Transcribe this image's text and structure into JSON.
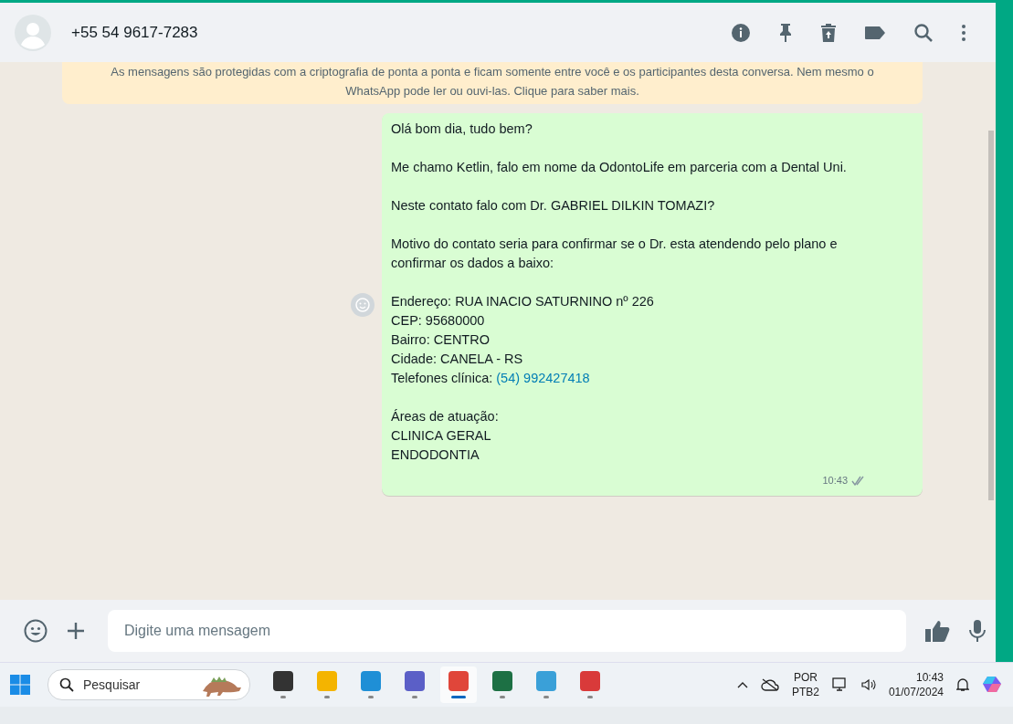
{
  "header": {
    "contact": "+55 54 9617-7283"
  },
  "notice": {
    "text": "As mensagens são protegidas com a criptografia de ponta a ponta e ficam somente entre você e os participantes desta conversa. Nem mesmo o WhatsApp pode ler ou ouvi-las. Clique para saber mais."
  },
  "message": {
    "paragraphs": [
      [
        {
          "text": "Olá bom dia, tudo bem?"
        }
      ],
      [
        {
          "text": "Me chamo Ketlin, falo em nome da OdontoLife em parceria com a Dental Uni."
        }
      ],
      [
        {
          "text": "Neste contato falo com Dr. GABRIEL DILKIN TOMAZI?"
        }
      ],
      [
        {
          "text": "Motivo do contato seria para confirmar se o Dr. esta atendendo pelo plano e confirmar os dados a baixo:"
        }
      ],
      [
        {
          "text": "Endereço: RUA INACIO SATURNINO nº 226"
        },
        {
          "text": "CEP: 95680000"
        },
        {
          "text": "Bairro: CENTRO"
        },
        {
          "text": "Cidade: CANELA - RS"
        },
        {
          "text": "Telefones clínica: ",
          "link": "(54) 992427418"
        }
      ],
      [
        {
          "text": "Áreas de atuação:"
        },
        {
          "text": "CLINICA GERAL"
        },
        {
          "text": "ENDODONTIA"
        }
      ]
    ],
    "time": "10:43"
  },
  "composer": {
    "placeholder": "Digite uma mensagem"
  },
  "taskbar": {
    "search_placeholder": "Pesquisar",
    "apps": [
      {
        "kind": "taskview",
        "selected": false
      },
      {
        "kind": "files",
        "selected": false
      },
      {
        "kind": "edge",
        "selected": false
      },
      {
        "kind": "teams",
        "selected": false
      },
      {
        "kind": "chrome",
        "selected": true
      },
      {
        "kind": "excel",
        "selected": false
      },
      {
        "kind": "notepad",
        "selected": false
      },
      {
        "kind": "snip",
        "selected": false
      }
    ],
    "language": "POR",
    "layout": "PTB2",
    "time": "10:43",
    "date": "01/07/2024"
  }
}
